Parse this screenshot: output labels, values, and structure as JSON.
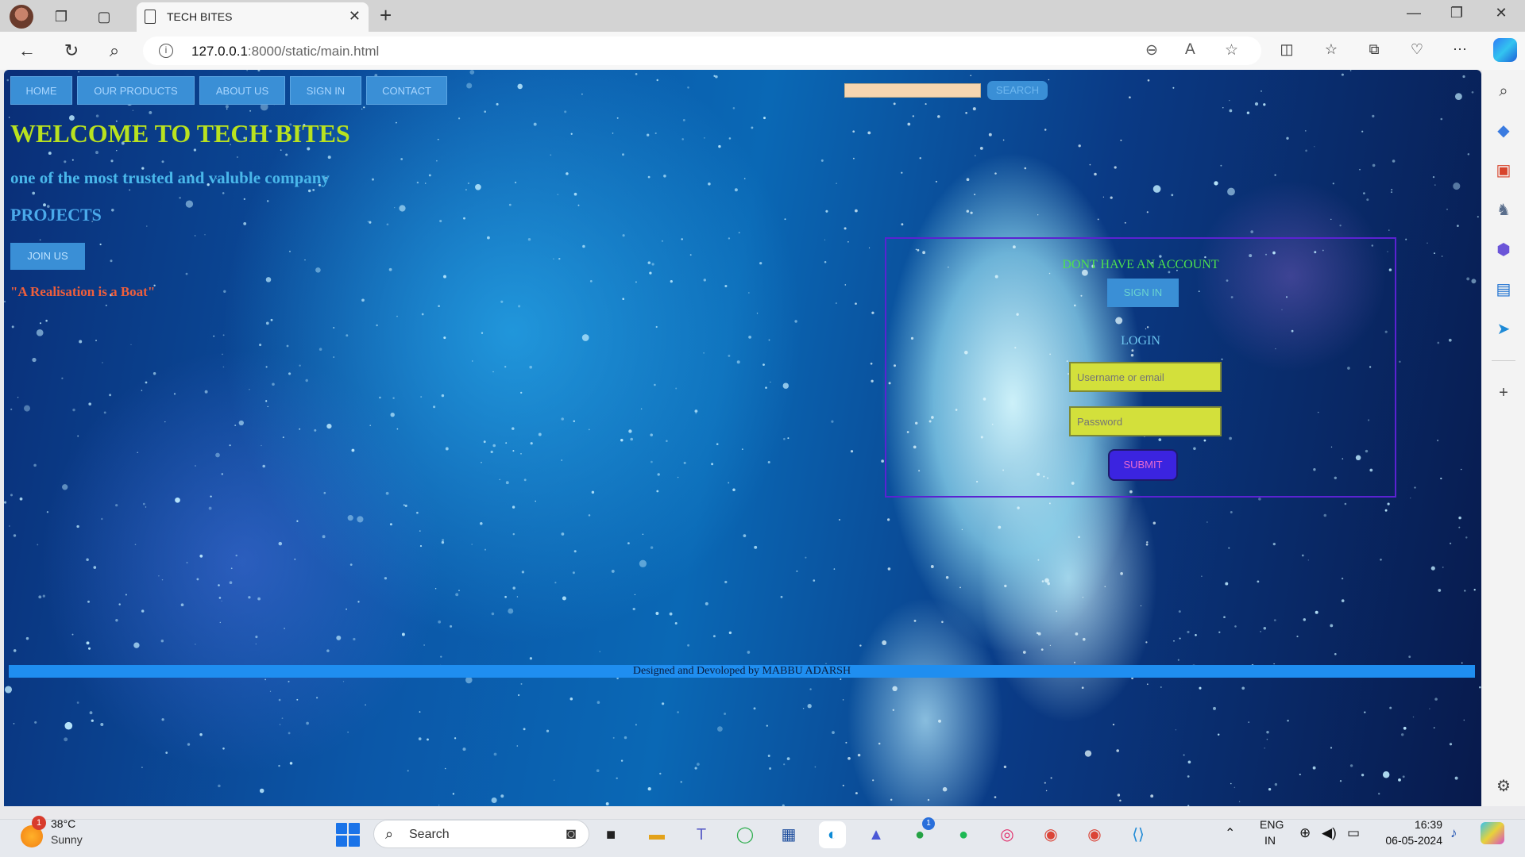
{
  "browser": {
    "tab_title": "TECH BITES",
    "url_host": "127.0.0.1",
    "url_rest": ":8000/static/main.html"
  },
  "page": {
    "nav": [
      "HOME",
      "OUR PRODUCTS",
      "ABOUT US",
      "SIGN IN",
      "CONTACT"
    ],
    "search_button": "SEARCH",
    "welcome": "WELCOME TO TECH BITES",
    "tagline": "one of the most trusted and valuble company",
    "projects": "PROJECTS",
    "join_button": "JOIN US",
    "quote": "\"A Realisation is a Boat\"",
    "login_box": {
      "no_account": "DONT HAVE AN ACCOUNT",
      "signin_button": "SIGN IN",
      "login_title": "LOGIN",
      "username_placeholder": "Username or email",
      "password_placeholder": "Password",
      "submit_button": "SUBMIT"
    },
    "footer": "Designed and Devoloped by MABBU ADARSH"
  },
  "taskbar": {
    "weather_temp": "38°C",
    "weather_cond": "Sunny",
    "weather_badge": "1",
    "search_label": "Search",
    "whatsapp_badge": "1",
    "lang_line1": "ENG",
    "lang_line2": "IN",
    "time": "16:39",
    "date": "06-05-2024"
  },
  "colors": {
    "nav_button": "#3a8fd6",
    "welcome_text": "#b9e21f",
    "login_border": "#5b22d2",
    "input_fill": "#d3e03b",
    "submit_fill": "#3b24e0",
    "footer_bar": "#1f8ef0"
  }
}
